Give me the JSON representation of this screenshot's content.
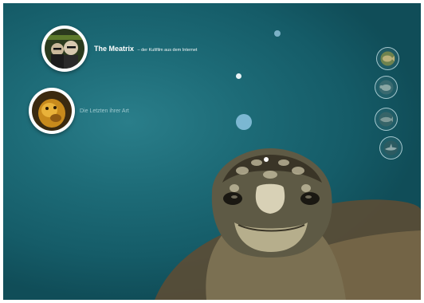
{
  "featured": [
    {
      "title": "The Meatrix",
      "subtitle": "– der Kultfilm aus dem Internet"
    },
    {
      "title": "Die Letzten ihrer Art"
    }
  ],
  "nav_icons": [
    "fish-icon",
    "turtle-icon",
    "whale-icon",
    "shark-icon"
  ],
  "colors": {
    "ocean": "#1d6b77",
    "ring": "#ffffff",
    "muted_text": "#9fc9cf"
  }
}
